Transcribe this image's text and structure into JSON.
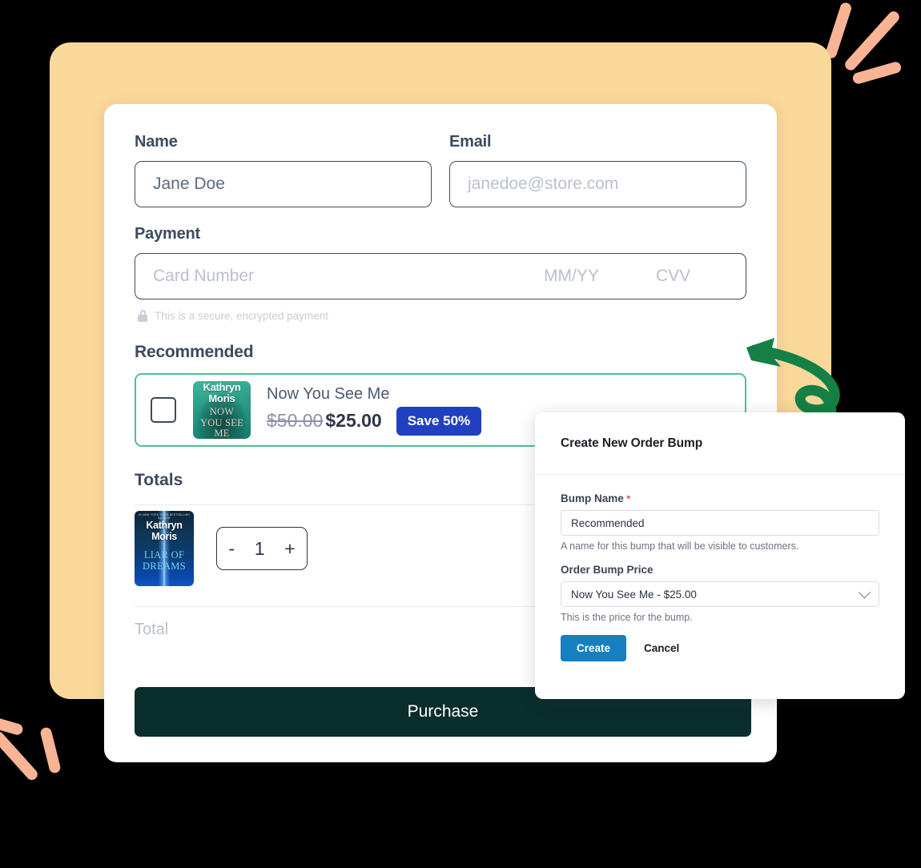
{
  "checkout": {
    "name": {
      "label": "Name",
      "value": "Jane Doe",
      "placeholder": "Jane Doe"
    },
    "email": {
      "label": "Email",
      "value": "",
      "placeholder": "janedoe@store.com"
    },
    "payment": {
      "label": "Payment",
      "card_placeholder": "Card Number",
      "expiry_placeholder": "MM/YY",
      "cvv_placeholder": "CVV",
      "secure_note": "This is a secure, encrypted payment",
      "lock_icon": "lock-icon"
    },
    "recommended": {
      "heading": "Recommended",
      "item": {
        "title": "Now You See Me",
        "old_price": "$50.00",
        "new_price": "$25.00",
        "badge": "Save 50%",
        "checked": false,
        "cover": {
          "author_line1": "Kathryn",
          "author_line2": "Moris",
          "title_line1": "NOW",
          "title_line2": "YOU SEE",
          "title_line3": "ME"
        }
      }
    },
    "totals": {
      "heading": "Totals",
      "quantity": "1",
      "decrement_label": "-",
      "increment_label": "+",
      "total_label": "Total",
      "cover": {
        "tagline": "#1 NEW YORK TIMES BESTSELLING AUTHOR",
        "author_line1": "Kathryn",
        "author_line2": "Moris",
        "title_line1": "LIAR OF",
        "title_line2": "DREAMS"
      }
    },
    "purchase_button": "Purchase"
  },
  "modal": {
    "title": "Create New Order Bump",
    "bump_name": {
      "label": "Bump Name",
      "required_marker": "*",
      "value": "Recommended",
      "help": "A name for this bump that will be visible to customers."
    },
    "bump_price": {
      "label": "Order Bump Price",
      "value": "Now You See Me - $25.00",
      "help": "This is the price for the bump.",
      "chevron_icon": "chevron-down-icon"
    },
    "create_button": "Create",
    "cancel_button": "Cancel"
  },
  "decor": {
    "arrow_icon": "curved-arrow-icon",
    "arrow_color": "#148046",
    "stroke_color": "#F9B395",
    "panel_color": "#FAD89A",
    "badge_color": "#2040C0",
    "create_color": "#157FBF",
    "purchase_color": "#0A2E2B",
    "bump_border_color": "#4FBF95"
  }
}
